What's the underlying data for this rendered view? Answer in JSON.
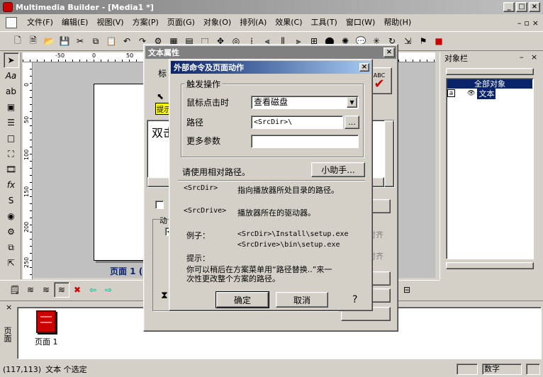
{
  "app": {
    "title": "Multimedia Builder - [Media1 *]"
  },
  "menu": [
    "文件(F)",
    "编辑(E)",
    "视图(V)",
    "方案(P)",
    "页面(G)",
    "对象(O)",
    "排列(A)",
    "效果(C)",
    "工具(T)",
    "窗口(W)",
    "帮助(H)"
  ],
  "ruler": {
    "top": [
      "-50",
      "0",
      "50"
    ],
    "left": [
      "0",
      "50",
      "100",
      "150",
      "200",
      "250"
    ]
  },
  "canvas": {
    "page_label": "页面 1 ("
  },
  "pages": {
    "side_label": "页面",
    "thumb_label": "页面 1"
  },
  "objects_panel": {
    "title": "对象栏",
    "group_header": "全部对象",
    "item_label": "文本"
  },
  "status": {
    "coords": "(117,113)",
    "message": "文本 个选定",
    "mode": "数字"
  },
  "text_props": {
    "title": "文本属性",
    "label_prefix": "标",
    "tip": "提示",
    "preview_text": "双击",
    "abc": "ABC",
    "action_label": "动",
    "right_buttons": [
      "对齐",
      "对齐"
    ]
  },
  "dialog": {
    "title": "外部命令及页面动作",
    "group_title": "触发操作",
    "trigger_label": "鼠标点击时",
    "trigger_value": "查看磁盘",
    "path_label": "路径",
    "path_value": "<SrcDir>\\",
    "browse_label": "...",
    "params_label": "更多参数",
    "params_value": "",
    "hint": "请使用相对路径。",
    "helper_button": "小助手...",
    "srcdir_key": "<SrcDir>",
    "srcdir_desc": "指向播放器所处目录的路径。",
    "srcdrive_key": "<SrcDrive>",
    "srcdrive_desc": "播放器所在的驱动器。",
    "example_label": "例子：",
    "example_1": "<SrcDir>\\Install\\setup.exe",
    "example_2": "<SrcDrive>\\bin\\setup.exe",
    "tip_label": "提示：",
    "tip_line1": "你可以稍后在方案菜单用“路径替换..”来一",
    "tip_line2": "次性更改整个方案的路径。",
    "ok": "确定",
    "cancel": "取消",
    "help": "?"
  },
  "colors": {
    "titlebar": "#0a246a",
    "titlebar_end": "#a6caf0",
    "inactive_caption": "#808080",
    "selection": "#0a246a"
  }
}
